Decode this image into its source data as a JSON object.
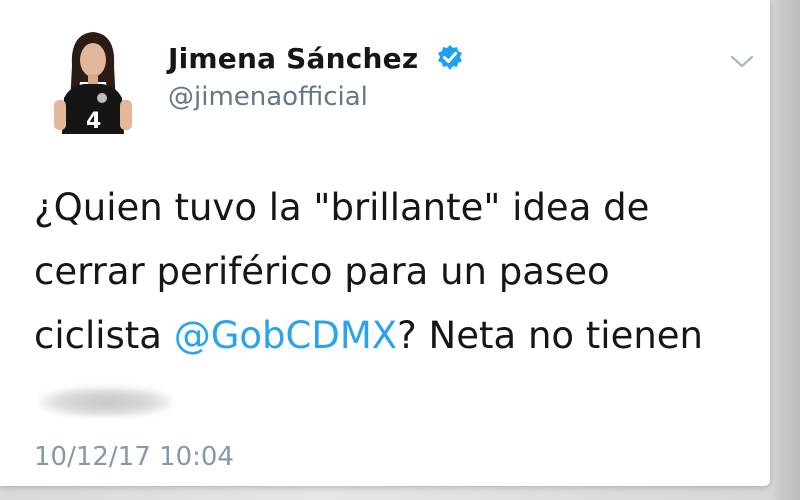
{
  "tweet": {
    "author": {
      "name": "Jimena Sánchez",
      "handle": "@jimenaofficial",
      "verified": true,
      "avatar_icon": "profile-photo-icon",
      "jersey_number": "4"
    },
    "menu_icon": "chevron-down-icon",
    "text_parts": {
      "line1": "¿Quien tuvo la \"brillante\" idea de cerrar periférico para un paseo ciclista ",
      "mention": "@GobCDMX",
      "line2": "? Neta no tienen",
      "censored_word": "madre"
    },
    "timestamp": "10/12/17 10:04"
  },
  "colors": {
    "name_text": "#14171a",
    "handle_text": "#657786",
    "mention_link": "#2aa3ef",
    "verified_badge": "#1da1f2",
    "timestamp_text": "#8899a6"
  }
}
